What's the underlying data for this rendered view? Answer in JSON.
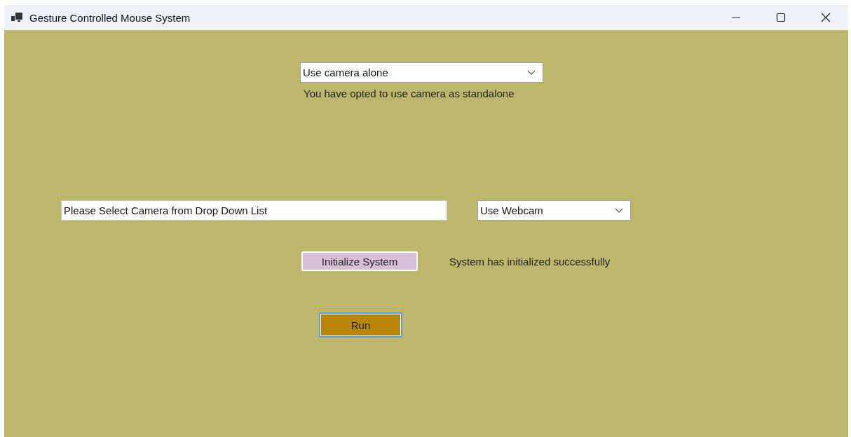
{
  "window": {
    "title": "Gesture Controlled Mouse System"
  },
  "mode_dropdown": {
    "value": "Use camera alone"
  },
  "mode_message": "You have opted to use camera as standalone",
  "camera_field": {
    "value": "Please Select Camera from Drop Down List"
  },
  "camera_dropdown": {
    "value": "Use Webcam"
  },
  "initialize_button": {
    "label": "Initialize System"
  },
  "init_status": "System has initialized successfully",
  "run_button": {
    "label": "Run",
    "focused": true
  }
}
